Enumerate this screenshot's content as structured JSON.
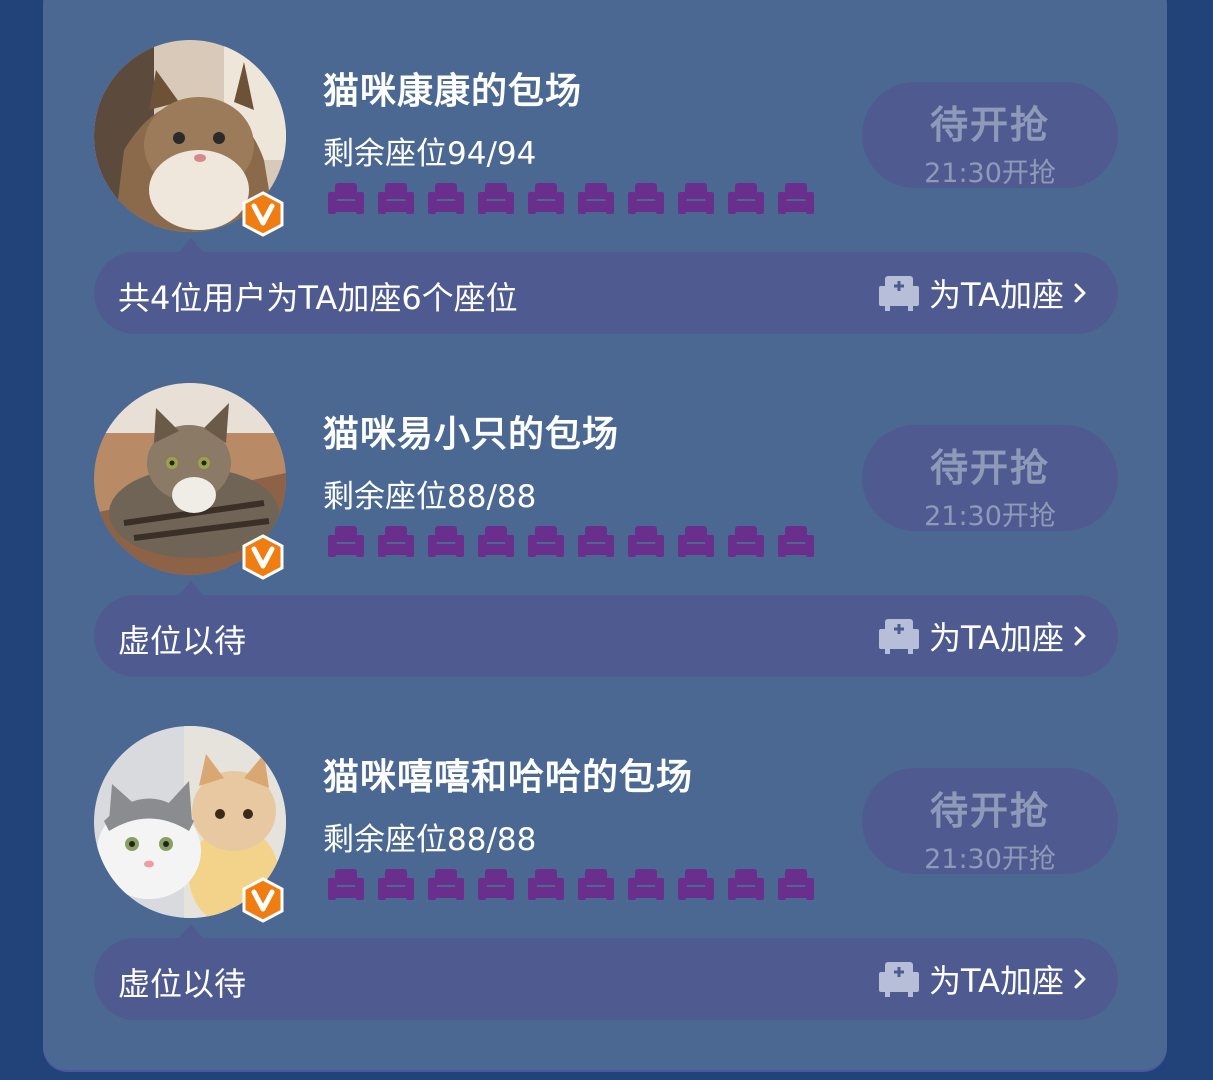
{
  "rooms": [
    {
      "title": "猫咪康康的包场",
      "seats_label": "剩余座位94/94",
      "button_main": "待开抢",
      "button_sub": "21:30开抢",
      "support_text": "共4位用户为TA加座6个座位",
      "add_seat_label": "为TA加座"
    },
    {
      "title": "猫咪易小只的包场",
      "seats_label": "剩余座位88/88",
      "button_main": "待开抢",
      "button_sub": "21:30开抢",
      "support_text": "虚位以待",
      "add_seat_label": "为TA加座"
    },
    {
      "title": "猫咪嘻嘻和哈哈的包场",
      "seats_label": "剩余座位88/88",
      "button_main": "待开抢",
      "button_sub": "21:30开抢",
      "support_text": "虚位以待",
      "add_seat_label": "为TA加座"
    }
  ],
  "badge_letter": "V",
  "icons": {
    "seat": "armchair-icon",
    "add_seat": "add-seat-icon",
    "chevron": "chevron-right-icon",
    "badge": "verified-v-badge-icon"
  },
  "colors": {
    "page_bg": "#21437a",
    "panel_bg": "#4a6891",
    "pill_bg": "#4f5b90",
    "seat": "#6a2f8c",
    "badge": "#f07d12",
    "button_text": "#8f9ab9"
  }
}
